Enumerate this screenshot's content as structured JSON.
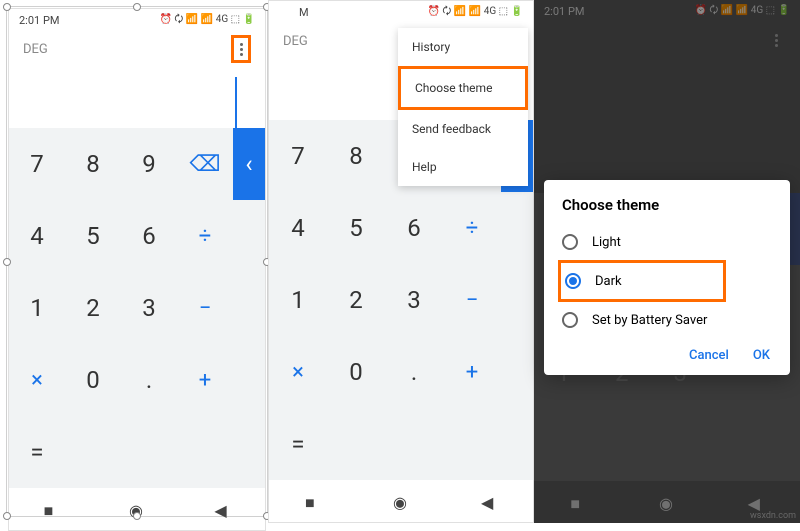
{
  "status": {
    "time": "2:01 PM",
    "network": "4G",
    "icons": "⏰ 🗘 📶 📶 4G ⬚ 🔋"
  },
  "calc": {
    "deg": "DEG",
    "keys": [
      "7",
      "8",
      "9",
      "4",
      "5",
      "6",
      "1",
      "2",
      "3",
      "0",
      "."
    ],
    "ops": {
      "div": "÷",
      "mul": "×",
      "sub": "−",
      "add": "+",
      "eq": "=",
      "bksp": "⌫",
      "expand": "‹"
    }
  },
  "menu": {
    "items": [
      "History",
      "Choose theme",
      "Send feedback",
      "Help"
    ]
  },
  "dialog": {
    "title": "Choose theme",
    "options": [
      "Light",
      "Dark",
      "Set by Battery Saver"
    ],
    "cancel": "Cancel",
    "ok": "OK"
  },
  "watermark": "wsxdn.com"
}
